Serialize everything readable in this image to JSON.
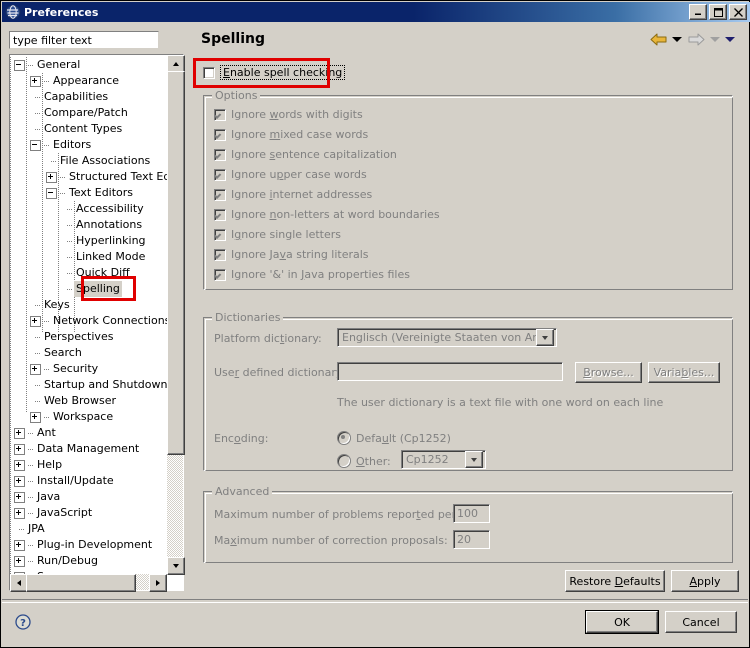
{
  "window": {
    "title": "Preferences",
    "icon": "eclipse-globe-icon",
    "minimize": "_",
    "maximize": "□",
    "close": "✕"
  },
  "sidebar": {
    "filter": {
      "value": "type filter text",
      "placeholder": "type filter text"
    },
    "items": [
      {
        "label": "General",
        "depth": 0,
        "twisty": "minus",
        "selected": false
      },
      {
        "label": "Appearance",
        "depth": 1,
        "twisty": "plus",
        "selected": false
      },
      {
        "label": "Capabilities",
        "depth": 1,
        "twisty": "none",
        "selected": false
      },
      {
        "label": "Compare/Patch",
        "depth": 1,
        "twisty": "none",
        "selected": false
      },
      {
        "label": "Content Types",
        "depth": 1,
        "twisty": "none",
        "selected": false
      },
      {
        "label": "Editors",
        "depth": 1,
        "twisty": "minus",
        "selected": false
      },
      {
        "label": "File Associations",
        "depth": 2,
        "twisty": "none",
        "selected": false
      },
      {
        "label": "Structured Text Edit",
        "depth": 2,
        "twisty": "plus",
        "selected": false
      },
      {
        "label": "Text Editors",
        "depth": 2,
        "twisty": "minus",
        "selected": false
      },
      {
        "label": "Accessibility",
        "depth": 3,
        "twisty": "none",
        "selected": false
      },
      {
        "label": "Annotations",
        "depth": 3,
        "twisty": "none",
        "selected": false
      },
      {
        "label": "Hyperlinking",
        "depth": 3,
        "twisty": "none",
        "selected": false
      },
      {
        "label": "Linked Mode",
        "depth": 3,
        "twisty": "none",
        "selected": false
      },
      {
        "label": "Quick Diff",
        "depth": 3,
        "twisty": "none",
        "selected": false
      },
      {
        "label": "Spelling",
        "depth": 3,
        "twisty": "none",
        "selected": true
      },
      {
        "label": "Keys",
        "depth": 1,
        "twisty": "none",
        "selected": false
      },
      {
        "label": "Network Connections",
        "depth": 1,
        "twisty": "plus",
        "selected": false
      },
      {
        "label": "Perspectives",
        "depth": 1,
        "twisty": "none",
        "selected": false
      },
      {
        "label": "Search",
        "depth": 1,
        "twisty": "none",
        "selected": false
      },
      {
        "label": "Security",
        "depth": 1,
        "twisty": "plus",
        "selected": false
      },
      {
        "label": "Startup and Shutdown",
        "depth": 1,
        "twisty": "none",
        "selected": false
      },
      {
        "label": "Web Browser",
        "depth": 1,
        "twisty": "none",
        "selected": false
      },
      {
        "label": "Workspace",
        "depth": 1,
        "twisty": "plus",
        "selected": false
      },
      {
        "label": "Ant",
        "depth": 0,
        "twisty": "plus",
        "selected": false
      },
      {
        "label": "Data Management",
        "depth": 0,
        "twisty": "plus",
        "selected": false
      },
      {
        "label": "Help",
        "depth": 0,
        "twisty": "plus",
        "selected": false
      },
      {
        "label": "Install/Update",
        "depth": 0,
        "twisty": "plus",
        "selected": false
      },
      {
        "label": "Java",
        "depth": 0,
        "twisty": "plus",
        "selected": false
      },
      {
        "label": "JavaScript",
        "depth": 0,
        "twisty": "plus",
        "selected": false
      },
      {
        "label": "JPA",
        "depth": 0,
        "twisty": "none",
        "selected": false
      },
      {
        "label": "Plug-in Development",
        "depth": 0,
        "twisty": "plus",
        "selected": false
      },
      {
        "label": "Run/Debug",
        "depth": 0,
        "twisty": "plus",
        "selected": false
      },
      {
        "label": "Server",
        "depth": 0,
        "twisty": "plus",
        "selected": false
      }
    ]
  },
  "page": {
    "title": "Spelling",
    "nav": {
      "back_icon": "back-arrow-icon",
      "back_menu_icon": "chevron-down-icon",
      "forward_icon": "forward-arrow-icon",
      "forward_menu_icon": "chevron-down-icon",
      "history_icon": "chevron-down-icon"
    },
    "enable": {
      "label": "Enable spell checking",
      "mnemonic": "E",
      "checked": false,
      "focused": true
    },
    "options": {
      "title": "Options",
      "items": [
        {
          "label": "Ignore words with digits",
          "pre": "Ignore ",
          "mn": "w",
          "post": "ords with digits",
          "checked": true
        },
        {
          "label": "Ignore mixed case words",
          "pre": "Ignore ",
          "mn": "m",
          "post": "ixed case words",
          "checked": true
        },
        {
          "label": "Ignore sentence capitalization",
          "pre": "Ignore ",
          "mn": "s",
          "post": "entence capitalization",
          "checked": true
        },
        {
          "label": "Ignore upper case words",
          "pre": "Ignore u",
          "mn": "p",
          "post": "per case words",
          "checked": true
        },
        {
          "label": "Ignore internet addresses",
          "pre": "Ignore ",
          "mn": "i",
          "post": "nternet addresses",
          "checked": true
        },
        {
          "label": "Ignore non-letters at word boundaries",
          "pre": "Ignore ",
          "mn": "n",
          "post": "on-letters at word boundaries",
          "checked": true
        },
        {
          "label": "Ignore single letters",
          "pre": "I",
          "mn": "g",
          "post": "nore single letters",
          "checked": true
        },
        {
          "label": "Ignore Java string literals",
          "pre": "Ignore Ja",
          "mn": "v",
          "post": "a string literals",
          "checked": true
        },
        {
          "label": "Ignore '&' in Java properties files",
          "pre": "Ignore '&' in ",
          "mn": "J",
          "post": "ava properties files",
          "checked": true
        }
      ]
    },
    "dictionaries": {
      "title": "Dictionaries",
      "platform_label_pre": "Platform dic",
      "platform_label_mn": "t",
      "platform_label_post": "ionary:",
      "platform_label": "Platform dictionary:",
      "platform_value": "Englisch (Vereinigte Staaten von Amerika)",
      "user_label_pre": "Use",
      "user_label_mn": "r",
      "user_label_post": " defined dictionary:",
      "user_label": "User defined dictionary:",
      "user_value": "",
      "browse_pre": "",
      "browse_mn": "B",
      "browse_post": "rowse...",
      "browse_label": "Browse...",
      "variables_pre": "Varia",
      "variables_mn": "b",
      "variables_post": "les...",
      "variables_label": "Variables...",
      "hint": "The user dictionary is a text file with one word on each line",
      "encoding_label_pre": "Enc",
      "encoding_label_mn": "o",
      "encoding_label_post": "ding:",
      "encoding_label": "Encoding:",
      "default_pre": "Defa",
      "default_mn": "u",
      "default_post": "lt (Cp1252)",
      "default_label": "Default (Cp1252)",
      "default_selected": true,
      "other_pre": "",
      "other_mn": "O",
      "other_post": "ther:",
      "other_label": "Other:",
      "other_selected": false,
      "other_value": "Cp1252"
    },
    "advanced": {
      "title": "Advanced",
      "max_problems_pre": "Maximum number of problems repor",
      "max_problems_mn": "t",
      "max_problems_post": "ed per file:",
      "max_problems_label": "Maximum number of problems reported per file:",
      "max_problems_value": "100",
      "max_proposals_pre": "Ma",
      "max_proposals_mn": "x",
      "max_proposals_post": "imum number of correction proposals:",
      "max_proposals_label": "Maximum number of correction proposals:",
      "max_proposals_value": "20"
    },
    "restore_defaults_pre": "Restore ",
    "restore_defaults_mn": "D",
    "restore_defaults_post": "efaults",
    "restore_defaults_label": "Restore Defaults",
    "apply_pre": "",
    "apply_mn": "A",
    "apply_post": "pply",
    "apply_label": "Apply"
  },
  "footer": {
    "help_icon": "help-question-icon",
    "ok_label": "OK",
    "cancel_label": "Cancel"
  },
  "annotations": {
    "enable_checkbox_highlight": "red-rectangle",
    "spelling-tree-item-highlight": "red-rectangle"
  },
  "colors": {
    "titlebar_start": "#0a246a",
    "titlebar_end": "#a6caf0",
    "face": "#d4d0c8",
    "disabled_text": "#808080",
    "annotation_red": "#e00000",
    "back_arrow": "#e8b53a"
  }
}
